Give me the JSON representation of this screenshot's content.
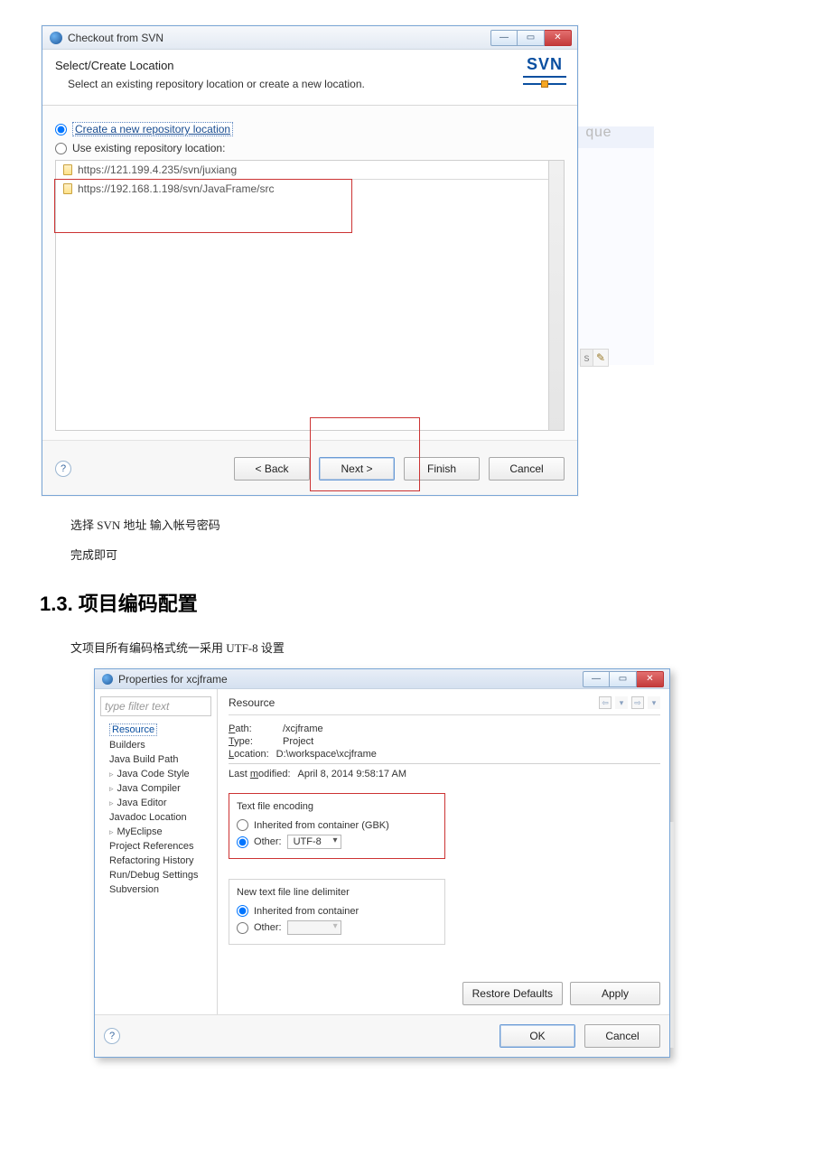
{
  "svn": {
    "window_title": "Checkout from SVN",
    "header_title": "Select/Create Location",
    "header_sub": "Select an existing repository location or create a new location.",
    "logo_text": "SVN",
    "radio_create": "Create a new repository location",
    "radio_existing": "Use existing repository location:",
    "repo1": "https://121.199.4.235/svn/juxiang",
    "repo2": "https://192.168.1.198/svn/JavaFrame/src",
    "btn_back": "< Back",
    "btn_next": "Next >",
    "btn_finish": "Finish",
    "btn_cancel": "Cancel",
    "help": "?",
    "bg_frag": "que",
    "bg_tag_s": "s"
  },
  "doc": {
    "p1": "选择 SVN 地址  输入帐号密码",
    "p2": "完成即可",
    "sec_title": "1.3.   项目编码配置",
    "p3": "文项目所有编码格式统一采用 UTF-8  设置"
  },
  "props": {
    "window_title": "Properties for xcjframe",
    "filter_placeholder": "type filter text",
    "tree": {
      "resource": "Resource",
      "builders": "Builders",
      "jbp": "Java Build Path",
      "jcs": "Java Code Style",
      "jc": "Java Compiler",
      "je": "Java Editor",
      "jl": "Javadoc Location",
      "me": "MyEclipse",
      "pr": "Project References",
      "rh": "Refactoring History",
      "rds": "Run/Debug Settings",
      "sv": "Subversion"
    },
    "right_title": "Resource",
    "path_k": "Path:",
    "path_v": "/xcjframe",
    "type_k": "Type:",
    "type_v": "Project",
    "loc_k": "Location:",
    "loc_v": "D:\\workspace\\xcjframe",
    "lm_k": "Last modified:",
    "lm_v": "April 8, 2014 9:58:17 AM",
    "enc_title": "Text file encoding",
    "enc_inherited": "Inherited from container (GBK)",
    "enc_other": "Other:",
    "enc_other_val": "UTF-8",
    "delim_title": "New text file line delimiter",
    "delim_inherited": "Inherited from container",
    "delim_other": "Other:",
    "btn_restore": "Restore Defaults",
    "btn_apply": "Apply",
    "btn_ok": "OK",
    "btn_cancel": "Cancel",
    "help": "?"
  }
}
